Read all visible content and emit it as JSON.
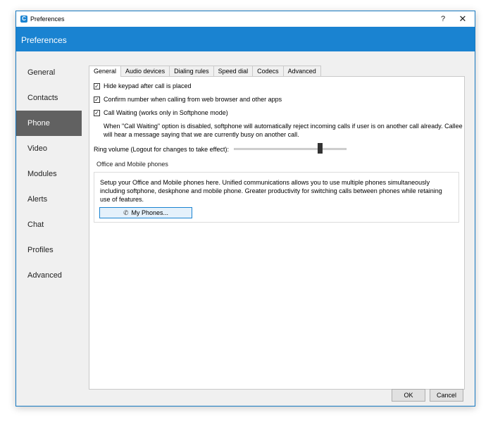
{
  "window": {
    "title": "Preferences",
    "icon": "app-c-icon",
    "help_glyph": "?",
    "close_glyph": "✕"
  },
  "header": {
    "title": "Preferences"
  },
  "sidebar": {
    "items": [
      {
        "label": "General"
      },
      {
        "label": "Contacts"
      },
      {
        "label": "Phone",
        "active": true
      },
      {
        "label": "Video"
      },
      {
        "label": "Modules"
      },
      {
        "label": "Alerts"
      },
      {
        "label": "Chat"
      },
      {
        "label": "Profiles"
      },
      {
        "label": "Advanced"
      }
    ]
  },
  "tabs": [
    {
      "label": "General",
      "active": true
    },
    {
      "label": "Audio devices"
    },
    {
      "label": "Dialing rules"
    },
    {
      "label": "Speed dial"
    },
    {
      "label": "Codecs"
    },
    {
      "label": "Advanced"
    }
  ],
  "general": {
    "checkboxes": [
      {
        "label": "Hide keypad after call is placed",
        "checked": true
      },
      {
        "label": "Confirm number when calling from web browser and other apps",
        "checked": true
      },
      {
        "label": "Call Waiting (works only in Softphone mode)",
        "checked": true
      }
    ],
    "call_waiting_note": "When \"Call Waiting\" option is disabled, softphone will automatically reject incoming calls if user is on another call already. Callee will hear a message saying that we are currently busy on another call.",
    "ring_volume_label": "Ring volume (Logout for changes to take effect):",
    "ring_volume_fraction": 0.78,
    "phones_group": {
      "title": "Office and Mobile phones",
      "text": "Setup your Office and Mobile phones here. Unified communications allows you to use multiple phones simultaneously including softphone, deskphone and mobile phone. Greater productivity for switching calls between phones while retaining use of features.",
      "button_label": "My Phones..."
    }
  },
  "footer": {
    "ok_label": "OK",
    "cancel_label": "Cancel"
  }
}
